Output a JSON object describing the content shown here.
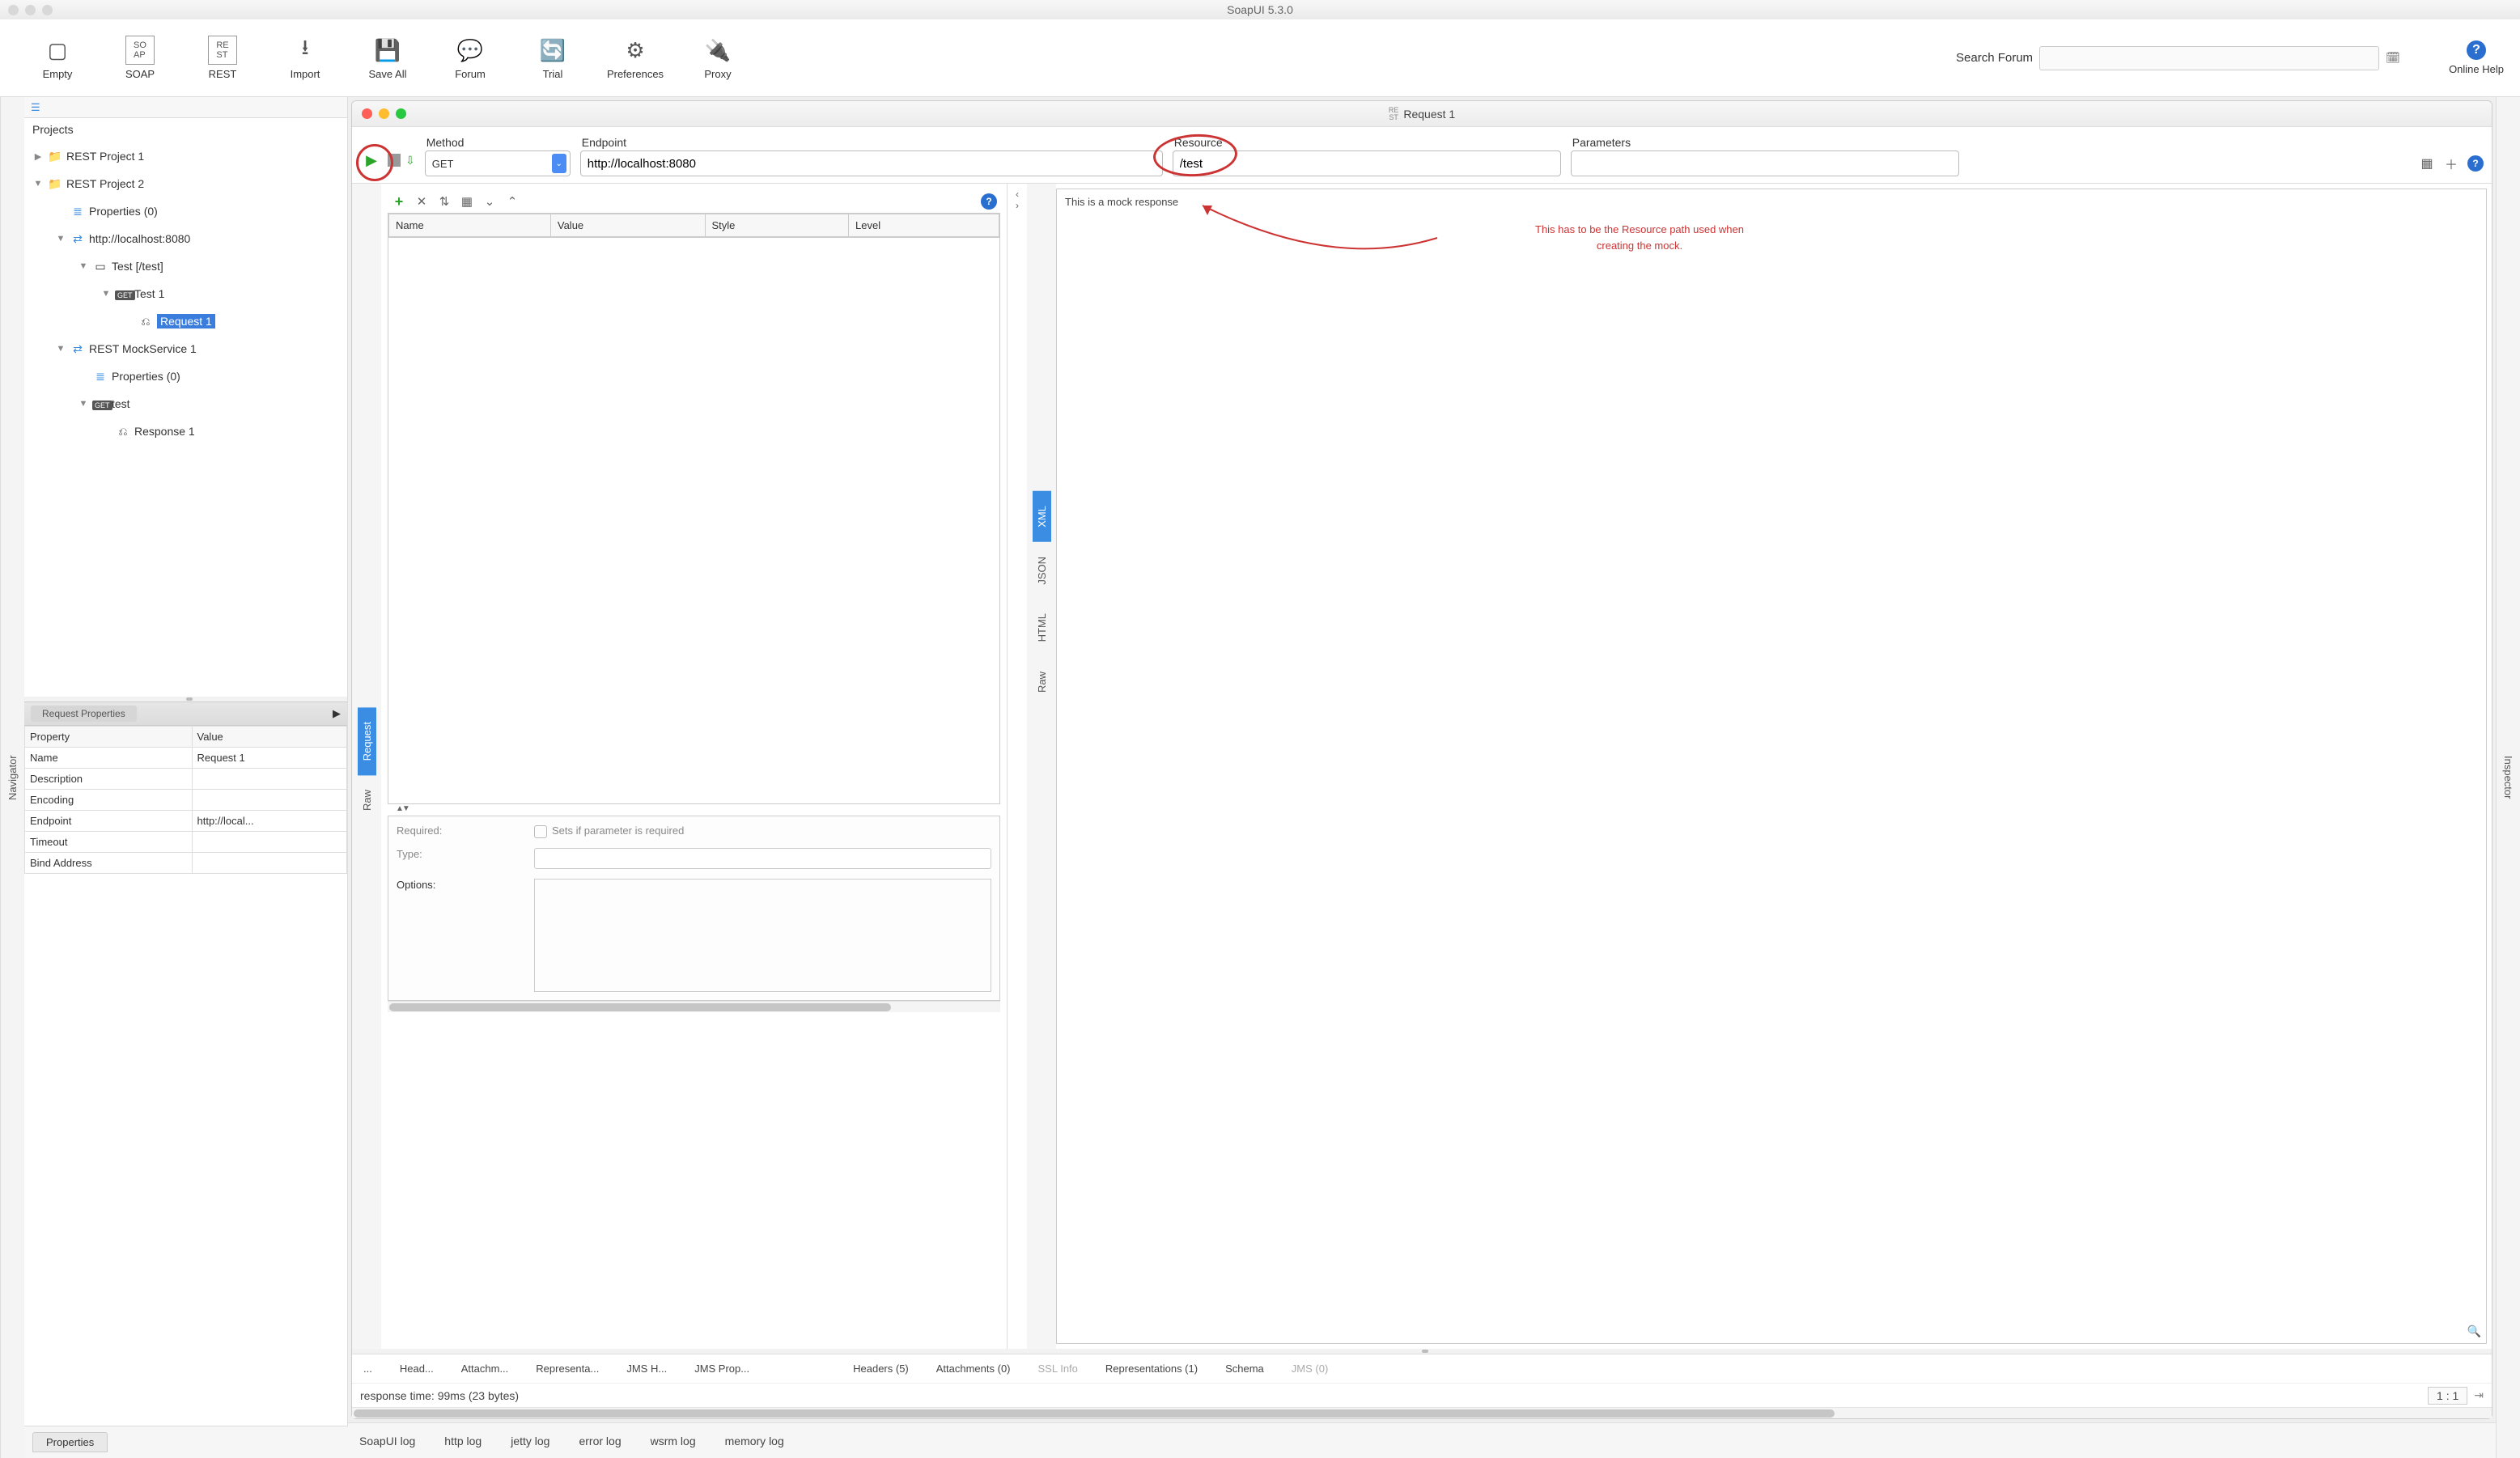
{
  "app_title": "SoapUI 5.3.0",
  "toolbar": [
    {
      "label": "Empty",
      "icon": "empty-icon"
    },
    {
      "label": "SOAP",
      "icon": "soap-icon"
    },
    {
      "label": "REST",
      "icon": "rest-icon"
    },
    {
      "label": "Import",
      "icon": "import-icon"
    },
    {
      "label": "Save All",
      "icon": "save-all-icon"
    },
    {
      "label": "Forum",
      "icon": "forum-icon"
    },
    {
      "label": "Trial",
      "icon": "trial-icon"
    },
    {
      "label": "Preferences",
      "icon": "preferences-icon"
    },
    {
      "label": "Proxy",
      "icon": "proxy-icon"
    }
  ],
  "search_forum_label": "Search Forum",
  "help_label": "Online Help",
  "side_tabs": {
    "left": "Navigator",
    "right": "Inspector"
  },
  "navigator": {
    "header": "Projects",
    "tree": [
      {
        "d": 0,
        "twist": "▶",
        "icon": "folder",
        "label": "REST Project 1"
      },
      {
        "d": 0,
        "twist": "▼",
        "icon": "folder",
        "label": "REST Project 2"
      },
      {
        "d": 1,
        "twist": "",
        "icon": "props",
        "label": "Properties (0)"
      },
      {
        "d": 1,
        "twist": "▼",
        "icon": "endpoint",
        "label": "http://localhost:8080"
      },
      {
        "d": 2,
        "twist": "▼",
        "icon": "resource",
        "label": "Test [/test]"
      },
      {
        "d": 3,
        "twist": "▼",
        "icon": "get",
        "label": "Test 1"
      },
      {
        "d": 4,
        "twist": "",
        "icon": "req",
        "label": "Request 1",
        "selected": true
      },
      {
        "d": 1,
        "twist": "▼",
        "icon": "mock",
        "label": "REST MockService 1"
      },
      {
        "d": 2,
        "twist": "",
        "icon": "props",
        "label": "Properties (0)"
      },
      {
        "d": 2,
        "twist": "▼",
        "icon": "get",
        "label": "test"
      },
      {
        "d": 3,
        "twist": "",
        "icon": "req",
        "label": "Response 1"
      }
    ]
  },
  "request_properties": {
    "title": "Request Properties",
    "cols": [
      "Property",
      "Value"
    ],
    "rows": [
      [
        "Name",
        "Request 1"
      ],
      [
        "Description",
        ""
      ],
      [
        "Encoding",
        ""
      ],
      [
        "Endpoint",
        "http://local..."
      ],
      [
        "Timeout",
        ""
      ],
      [
        "Bind Address",
        ""
      ]
    ]
  },
  "properties_tab": "Properties",
  "request_window": {
    "title": "Request 1",
    "fields": {
      "method_label": "Method",
      "method_value": "GET",
      "endpoint_label": "Endpoint",
      "endpoint_value": "http://localhost:8080",
      "resource_label": "Resource",
      "resource_value": "/test",
      "parameters_label": "Parameters",
      "parameters_value": ""
    },
    "param_cols": [
      "Name",
      "Value",
      "Style",
      "Level"
    ],
    "left_vtabs": [
      "Request",
      "Raw"
    ],
    "right_vtabs": [
      "XML",
      "JSON",
      "HTML",
      "Raw"
    ],
    "detail": {
      "required_label": "Required:",
      "required_desc": "Sets if parameter is required",
      "type_label": "Type:",
      "options_label": "Options:"
    },
    "response_text": "This is a mock response",
    "annotation": "This has to be the Resource path used when\ncreating the mock.",
    "bottom_left": [
      "...",
      "Head...",
      "Attachm...",
      "Representa...",
      "JMS H...",
      "JMS Prop..."
    ],
    "bottom_right": [
      "Headers (5)",
      "Attachments (0)",
      "SSL Info",
      "Representations (1)",
      "Schema",
      "JMS (0)"
    ],
    "status": "response time: 99ms (23 bytes)",
    "lineno": "1 : 1"
  },
  "logs": [
    "SoapUI log",
    "http log",
    "jetty log",
    "error log",
    "wsrm log",
    "memory log"
  ]
}
